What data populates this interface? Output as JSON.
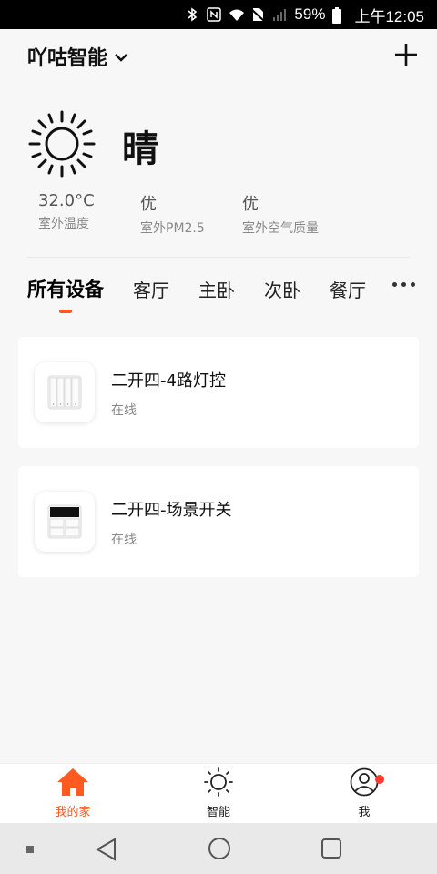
{
  "status_bar": {
    "battery": "59%",
    "time": "上午12:05"
  },
  "header": {
    "home_name": "吖咕智能"
  },
  "weather": {
    "condition": "晴",
    "stats": [
      {
        "value": "32.0°C",
        "label": "室外温度"
      },
      {
        "value": "优",
        "label": "室外PM2.5"
      },
      {
        "value": "优",
        "label": "室外空气质量"
      }
    ]
  },
  "tabs": [
    "所有设备",
    "客厅",
    "主卧",
    "次卧",
    "餐厅"
  ],
  "devices": [
    {
      "name": "二开四-4路灯控",
      "status": "在线"
    },
    {
      "name": "二开四-场景开关",
      "status": "在线"
    }
  ],
  "bottom_nav": {
    "home": "我的家",
    "smart": "智能",
    "me": "我"
  },
  "colors": {
    "accent": "#ff5a1f",
    "badge": "#ff3b30"
  }
}
